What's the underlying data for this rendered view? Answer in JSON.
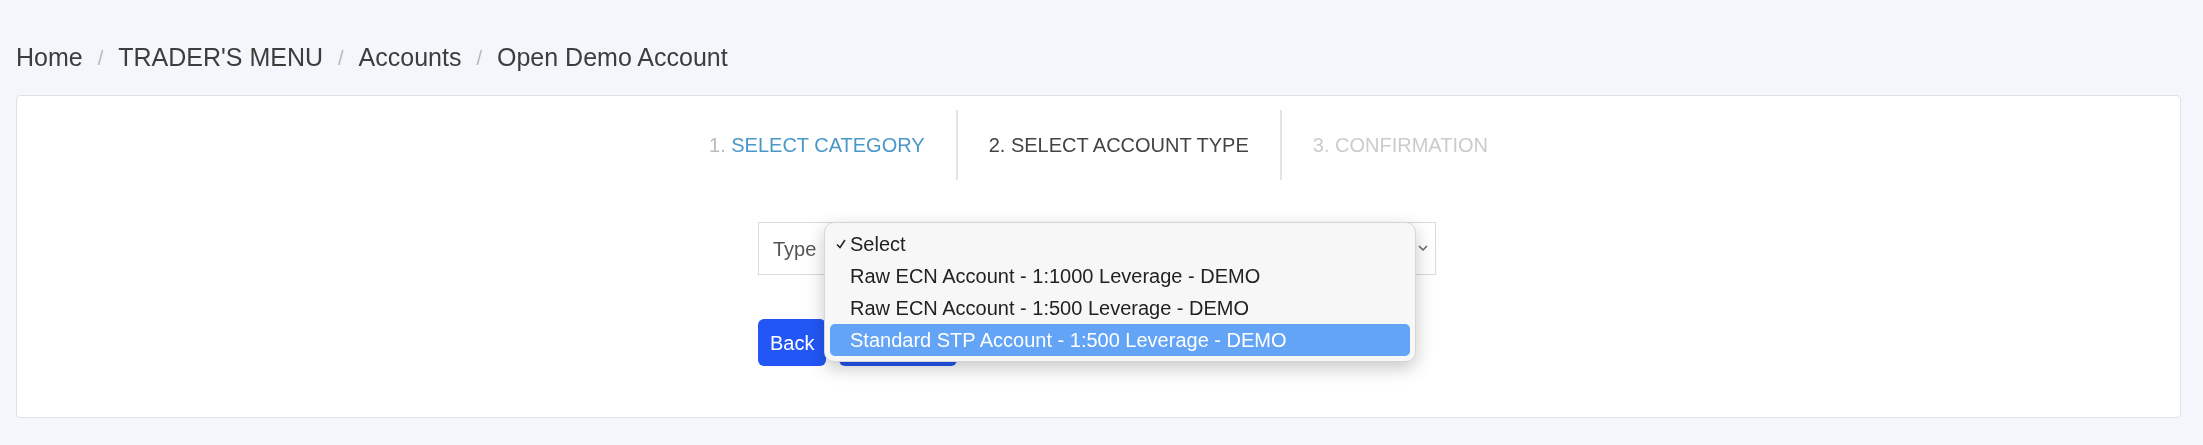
{
  "breadcrumb": [
    {
      "label": "Home"
    },
    {
      "separator": "/",
      "label": "TRADER'S MENU"
    },
    {
      "separator": "/",
      "label": "Accounts"
    },
    {
      "separator": "/",
      "label": "Open Demo Account"
    }
  ],
  "steps": [
    {
      "number": "1.",
      "label": "SELECT CATEGORY",
      "completed": true,
      "selected": false
    },
    {
      "number": "2.",
      "label": "SELECT ACCOUNT TYPE",
      "completed": false,
      "selected": true
    },
    {
      "number": "3.",
      "label": "CONFIRMATION",
      "completed": false,
      "selected": false
    }
  ],
  "type_field": {
    "label": "Type"
  },
  "dropdown": {
    "options": [
      {
        "label": "Select",
        "checked": true,
        "highlighted": false
      },
      {
        "label": "Raw ECN Account - 1:1000 Leverage - DEMO",
        "checked": false,
        "highlighted": false
      },
      {
        "label": "Raw ECN Account - 1:500 Leverage - DEMO",
        "checked": false,
        "highlighted": false
      },
      {
        "label": "Standard STP Account - 1:500 Leverage - DEMO",
        "checked": false,
        "highlighted": true
      }
    ]
  },
  "buttons": [
    {
      "label": "Back"
    }
  ]
}
